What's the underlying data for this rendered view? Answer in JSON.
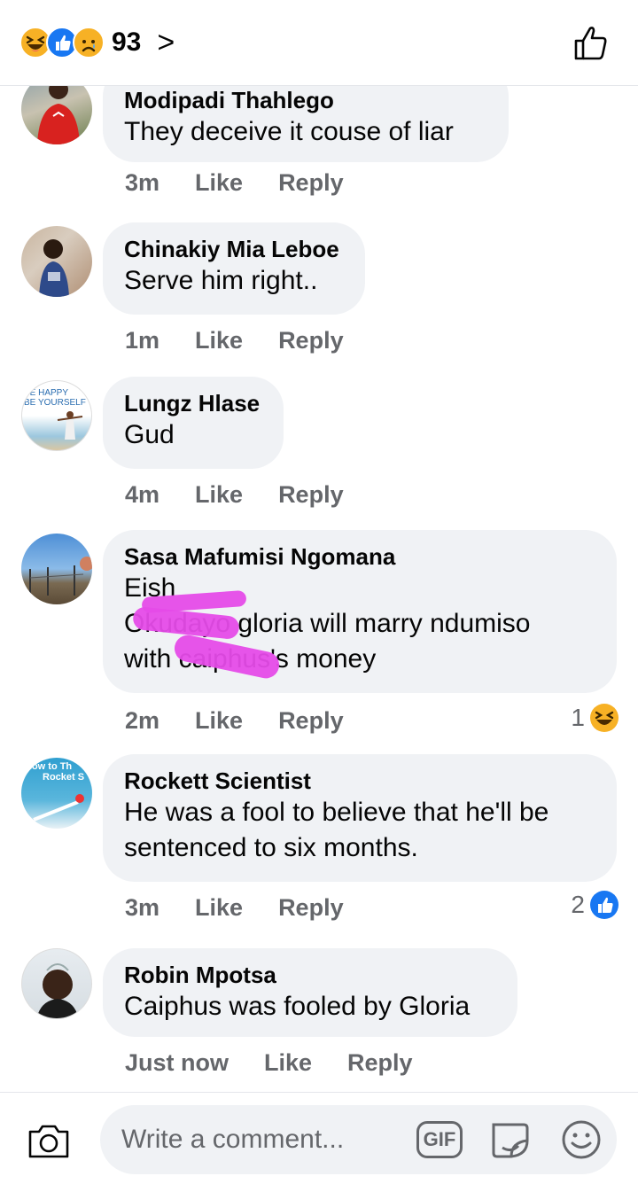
{
  "header": {
    "reactions": [
      "haha-icon",
      "like-icon",
      "sad-icon"
    ],
    "reaction_count": "93",
    "chevron": ">"
  },
  "comments": [
    {
      "author": "Modipadi Thahlego",
      "lines": [
        "They deceive it couse of liar"
      ],
      "time": "3m",
      "like": "Like",
      "reply": "Reply"
    },
    {
      "author": "Chinakiy Mia Leboe",
      "lines": [
        "Serve him right.."
      ],
      "time": "1m",
      "like": "Like",
      "reply": "Reply"
    },
    {
      "author": "Lungz Hlase",
      "lines": [
        "Gud"
      ],
      "time": "4m",
      "like": "Like",
      "reply": "Reply"
    },
    {
      "author": "Sasa Mafumisi Ngomana",
      "lines": [
        "Eish",
        "Okudayo gloria will marry ndumiso",
        "with caiphus's money"
      ],
      "time": "2m",
      "like": "Like",
      "reply": "Reply",
      "reactions": {
        "count": "1",
        "icon": "haha-icon"
      }
    },
    {
      "author": "Rockett Scientist",
      "lines": [
        "He was a fool to believe that he'll be",
        "sentenced to six months."
      ],
      "time": "3m",
      "like": "Like",
      "reply": "Reply",
      "reactions": {
        "count": "2",
        "icon": "like-icon"
      }
    },
    {
      "author": "Robin Mpotsa",
      "lines": [
        "Caiphus was fooled by Gloria"
      ],
      "time": "Just now",
      "like": "Like",
      "reply": "Reply"
    }
  ],
  "avatar_texts": {
    "lungz": [
      "BE HAPPY",
      "BE YOURSELF"
    ],
    "rockett": [
      "How to Th",
      "Rocket S"
    ]
  },
  "composer": {
    "placeholder": "Write a comment...",
    "gif_label": "GIF"
  },
  "colors": {
    "bubble": "#f0f2f5",
    "meta_text": "#65676b",
    "facebook_blue": "#1877f2",
    "reaction_yellow": "#f7b125",
    "redaction_marker": "#e54be8"
  }
}
